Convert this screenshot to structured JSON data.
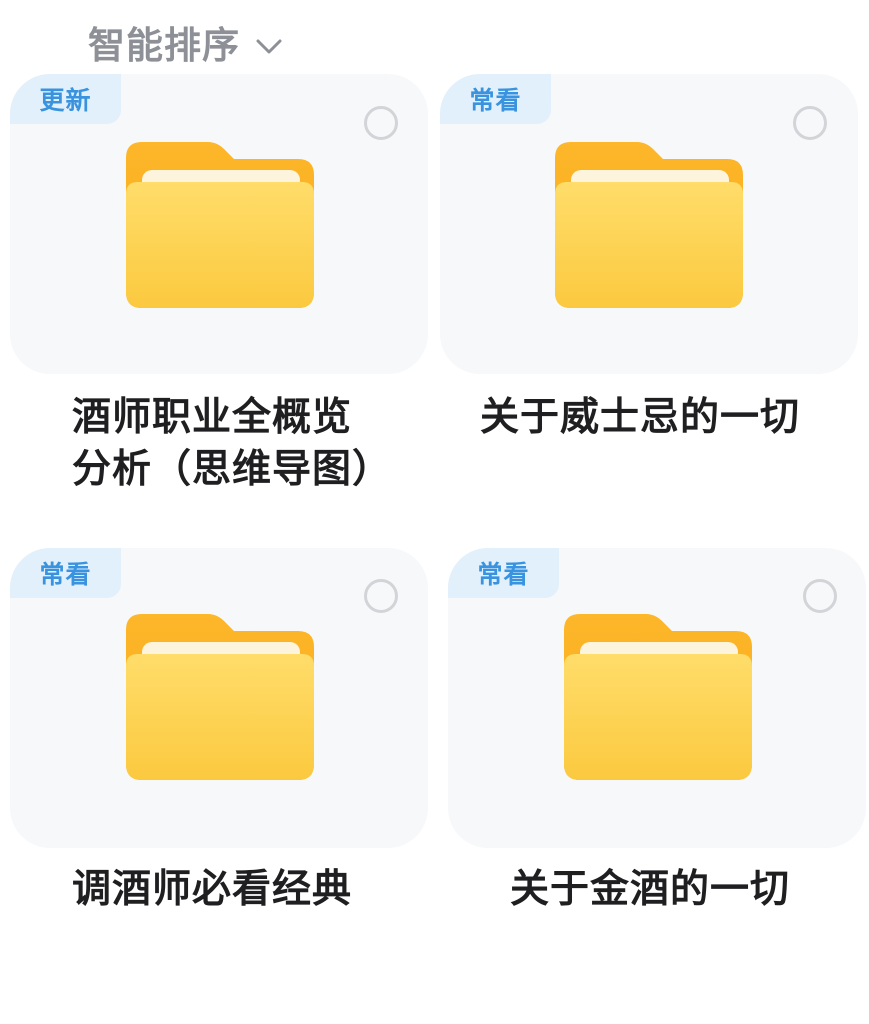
{
  "sort": {
    "label": "智能排序"
  },
  "folders": [
    {
      "badge": "更新",
      "title_line1": "酒师职业全概览",
      "title_line2": "分析（思维导图）"
    },
    {
      "badge": "常看",
      "title_line1": "关于威士忌的一切"
    },
    {
      "badge": "常看",
      "title_line1": "调酒师必看经典"
    },
    {
      "badge": "常看",
      "title_line1": "关于金酒的一切"
    }
  ],
  "colors": {
    "badge_bg": "#e2f0fb",
    "badge_text": "#3993df",
    "card_bg": "#f6f8fa",
    "folder_yellow": "#fcd04e"
  }
}
